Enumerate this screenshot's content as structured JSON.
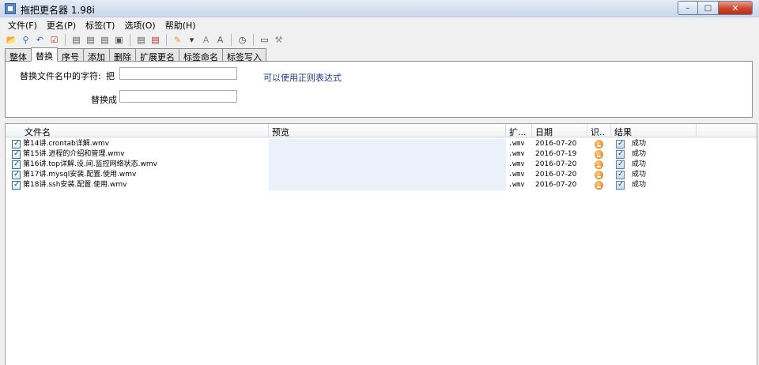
{
  "window": {
    "title": "拖把更名器 1.98i",
    "controls": {
      "minimize": "–",
      "maximize": "□",
      "close": "✕"
    }
  },
  "menu": [
    "文件(F)",
    "更名(P)",
    "标签(T)",
    "选项(O)",
    "帮助(H)"
  ],
  "toolbar": {
    "icons": [
      {
        "name": "open-folder-icon",
        "glyph": "📂",
        "color": "#d99a1c"
      },
      {
        "name": "search-icon",
        "glyph": "⚲",
        "color": "#2e6fb8"
      },
      {
        "name": "undo-icon",
        "glyph": "↶",
        "color": "#2e6fb8"
      },
      {
        "name": "check-icon",
        "glyph": "☑",
        "color": "#c0392b"
      },
      {
        "name": "list-icon-1",
        "glyph": "▤",
        "color": "#555555"
      },
      {
        "name": "list-icon-2",
        "glyph": "▤",
        "color": "#555555"
      },
      {
        "name": "list-icon-3",
        "glyph": "▤",
        "color": "#555555"
      },
      {
        "name": "list-icon-4",
        "glyph": "▣",
        "color": "#555555"
      },
      {
        "name": "document-icon",
        "glyph": "▤",
        "color": "#555555"
      },
      {
        "name": "document-red-icon",
        "glyph": "▤",
        "color": "#b03030"
      },
      {
        "name": "brush-icon",
        "glyph": "✎",
        "color": "#d99a1c"
      },
      {
        "name": "dropdown-arrow-icon",
        "glyph": "▾",
        "color": "#333333"
      },
      {
        "name": "font-icon-1",
        "glyph": "A",
        "color": "#8a8a8a"
      },
      {
        "name": "font-icon-2",
        "glyph": "A",
        "color": "#5a5a5a"
      },
      {
        "name": "clock-icon",
        "glyph": "◷",
        "color": "#333333"
      },
      {
        "name": "window-icon",
        "glyph": "▭",
        "color": "#333333"
      },
      {
        "name": "tool-icon",
        "glyph": "⚒",
        "color": "#8a8a8a"
      }
    ]
  },
  "tabs": [
    {
      "label": "整体",
      "active": false
    },
    {
      "label": "替换",
      "active": true
    },
    {
      "label": "序号",
      "active": false
    },
    {
      "label": "添加",
      "active": false
    },
    {
      "label": "删除",
      "active": false
    },
    {
      "label": "扩展更名",
      "active": false
    },
    {
      "label": "标签命名",
      "active": false
    },
    {
      "label": "标签写入",
      "active": false
    }
  ],
  "replace_panel": {
    "find_label": "替换文件名中的字符:",
    "ba_label": "把",
    "find_value": "",
    "replace_label": "替换成",
    "replace_value": "",
    "hint": "可以使用正则表达式"
  },
  "list": {
    "columns": {
      "name": "文件名",
      "preview": "预览",
      "ext": "扩...",
      "date": "日期",
      "id": "识..",
      "result": "结果"
    },
    "rows": [
      {
        "name": "第14讲.crontab详解.wmv",
        "preview": "",
        "ext": ".wmv",
        "date": "2016-07-20",
        "result": "成功"
      },
      {
        "name": "第15讲.进程的介绍和管理.wmv",
        "preview": "",
        "ext": ".wmv",
        "date": "2016-07-19",
        "result": "成功"
      },
      {
        "name": "第16讲.top详解.设.间.监控网络状态.wmv",
        "preview": "",
        "ext": ".wmv",
        "date": "2016-07-20",
        "result": "成功"
      },
      {
        "name": "第17讲.mysql安装.配置.使用.wmv",
        "preview": "",
        "ext": ".wmv",
        "date": "2016-07-20",
        "result": "成功"
      },
      {
        "name": "第18讲.ssh安装.配置.使用.wmv",
        "preview": "",
        "ext": ".wmv",
        "date": "2016-07-20",
        "result": "成功"
      }
    ]
  }
}
